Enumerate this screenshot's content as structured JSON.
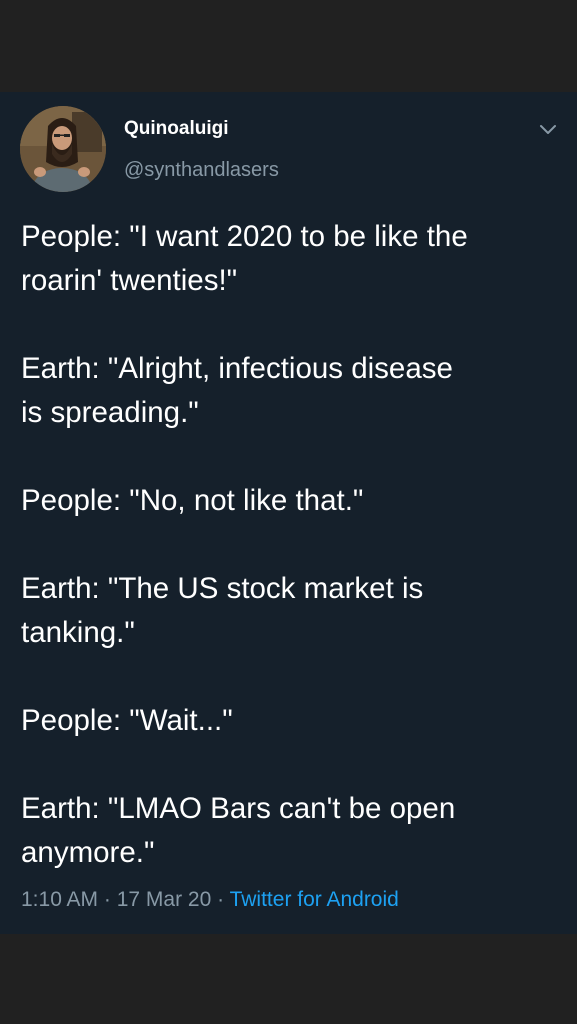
{
  "author": {
    "name": "Quinoaluigi",
    "handle": "@synthandlasers"
  },
  "tweet": {
    "paragraphs": [
      [
        "People: \"I want 2020 to be like the",
        "roarin' twenties!\""
      ],
      [
        "Earth: \"Alright, infectious disease",
        "is spreading.\""
      ],
      [
        "People: \"No, not like that.\""
      ],
      [
        "Earth: \"The US stock market is",
        "tanking.\""
      ],
      [
        "People: \"Wait...\""
      ],
      [
        "Earth: \"LMAO Bars can't be open",
        "anymore.\""
      ]
    ]
  },
  "meta": {
    "time": "1:10 AM",
    "separator": " · ",
    "date": "17 Mar 20",
    "source": "Twitter for Android"
  },
  "colors": {
    "background": "#212121",
    "card": "#15202b",
    "text": "#ffffff",
    "muted": "#8899a6",
    "link": "#1da1f2"
  },
  "icons": {
    "menu": "chevron-down-icon"
  }
}
